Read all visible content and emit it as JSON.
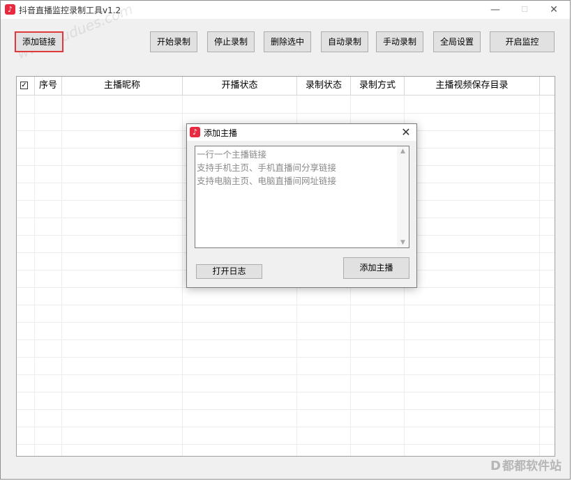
{
  "window": {
    "title": "抖音直播监控录制工具v1.2",
    "icon": "douyin-logo-icon",
    "controls": {
      "minimize": "—",
      "maximize": "☐",
      "close": "✕"
    }
  },
  "toolbar": {
    "add_link": "添加链接",
    "start_record": "开始录制",
    "stop_record": "停止录制",
    "delete_selected": "删除选中",
    "auto_record": "自动录制",
    "manual_record": "手动录制",
    "global_settings": "全局设置",
    "start_monitor": "开启监控"
  },
  "watermark": "www.dudues.com",
  "table": {
    "check_symbol": "✓",
    "columns": [
      "序号",
      "主播昵称",
      "开播状态",
      "录制状态",
      "录制方式",
      "主播视频保存目录"
    ],
    "rows": []
  },
  "dialog": {
    "title": "添加主播",
    "close": "✕",
    "placeholder_lines": [
      "一行一个主播链接",
      "支持手机主页、手机直播间分享链接",
      "支持电脑主页、电脑直播间网址链接"
    ],
    "open_log": "打开日志",
    "add_streamer": "添加主播"
  },
  "corner_watermark": {
    "icon": "D",
    "text": "都都软件站"
  },
  "colors": {
    "highlight_border": "#e0383a",
    "app_icon": "#e8293f"
  }
}
